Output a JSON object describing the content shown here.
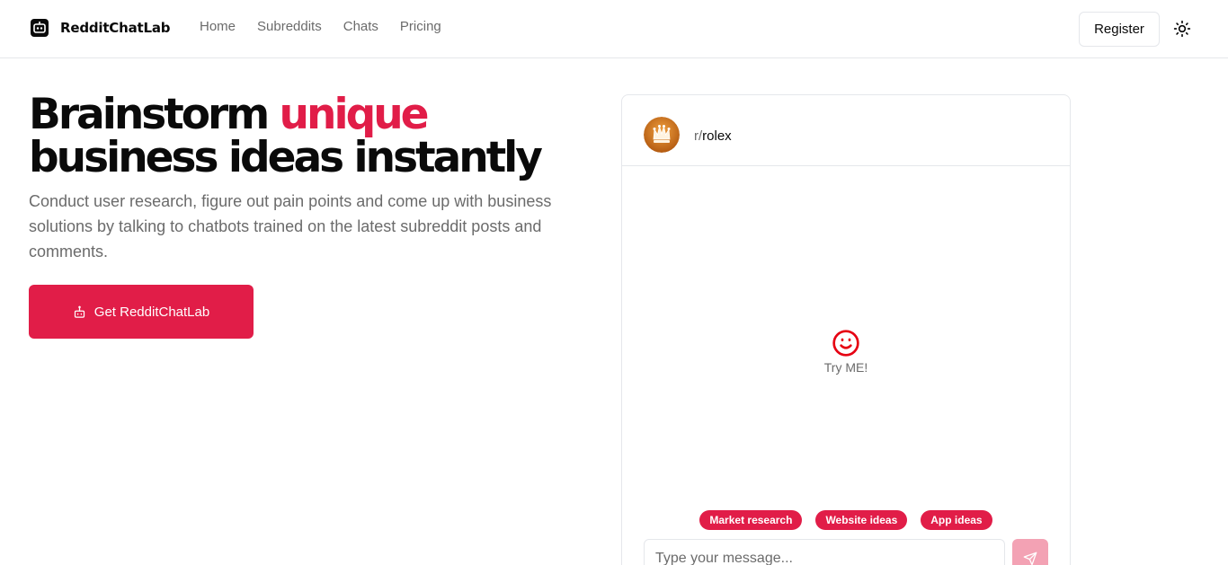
{
  "header": {
    "brand": "RedditChatLab",
    "nav": [
      {
        "label": "Home"
      },
      {
        "label": "Subreddits"
      },
      {
        "label": "Chats"
      },
      {
        "label": "Pricing"
      }
    ],
    "register_label": "Register",
    "theme_icon": "sun-icon"
  },
  "hero": {
    "title_before": "Brainstorm ",
    "title_accent": "unique",
    "title_after": " business ideas instantly",
    "subtitle": "Conduct user research, figure out pain points and come up with business solutions by talking to chatbots trained on the latest subreddit posts and comments.",
    "cta_label": "Get RedditChatLab",
    "cta_icon": "robot-icon"
  },
  "chat": {
    "subreddit_prefix": "r/",
    "subreddit_name": "rolex",
    "empty_icon": "smile-icon",
    "empty_text": "Try ME!",
    "suggestions": [
      {
        "label": "Market research"
      },
      {
        "label": "Website ideas"
      },
      {
        "label": "App ideas"
      }
    ],
    "input_placeholder": "Type your message...",
    "input_value": "",
    "send_icon": "send-icon"
  },
  "colors": {
    "accent": "#e11d48",
    "muted_text": "#6b6b6b",
    "border": "#e5e7eb",
    "send_disabled": "#f3a2b4"
  }
}
